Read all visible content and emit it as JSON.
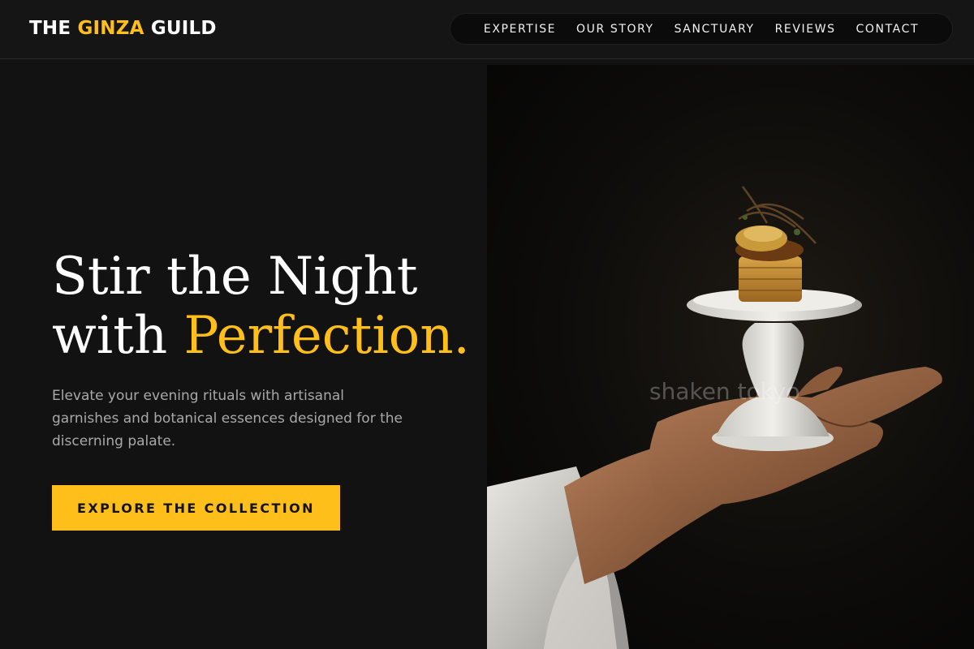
{
  "header": {
    "logo": {
      "part1": "THE ",
      "part2": "GINZA",
      "part3": " GUILD"
    },
    "nav": [
      {
        "label": "EXPERTISE"
      },
      {
        "label": "OUR STORY"
      },
      {
        "label": "SANCTUARY"
      },
      {
        "label": "REVIEWS"
      },
      {
        "label": "CONTACT"
      }
    ]
  },
  "hero": {
    "title_line1": "Stir the Night",
    "title_line2_plain": "with ",
    "title_line2_accent": "Perfection.",
    "description": "Elevate your evening rituals with artisanal garnishes and botanical essences designed for the discerning palate.",
    "cta_label": "EXPLORE THE COLLECTION",
    "image_watermark": "shaken tokyo"
  },
  "colors": {
    "accent": "#ffbf1a",
    "background": "#121212",
    "text": "#ffffff",
    "muted": "#a9a9a9"
  }
}
